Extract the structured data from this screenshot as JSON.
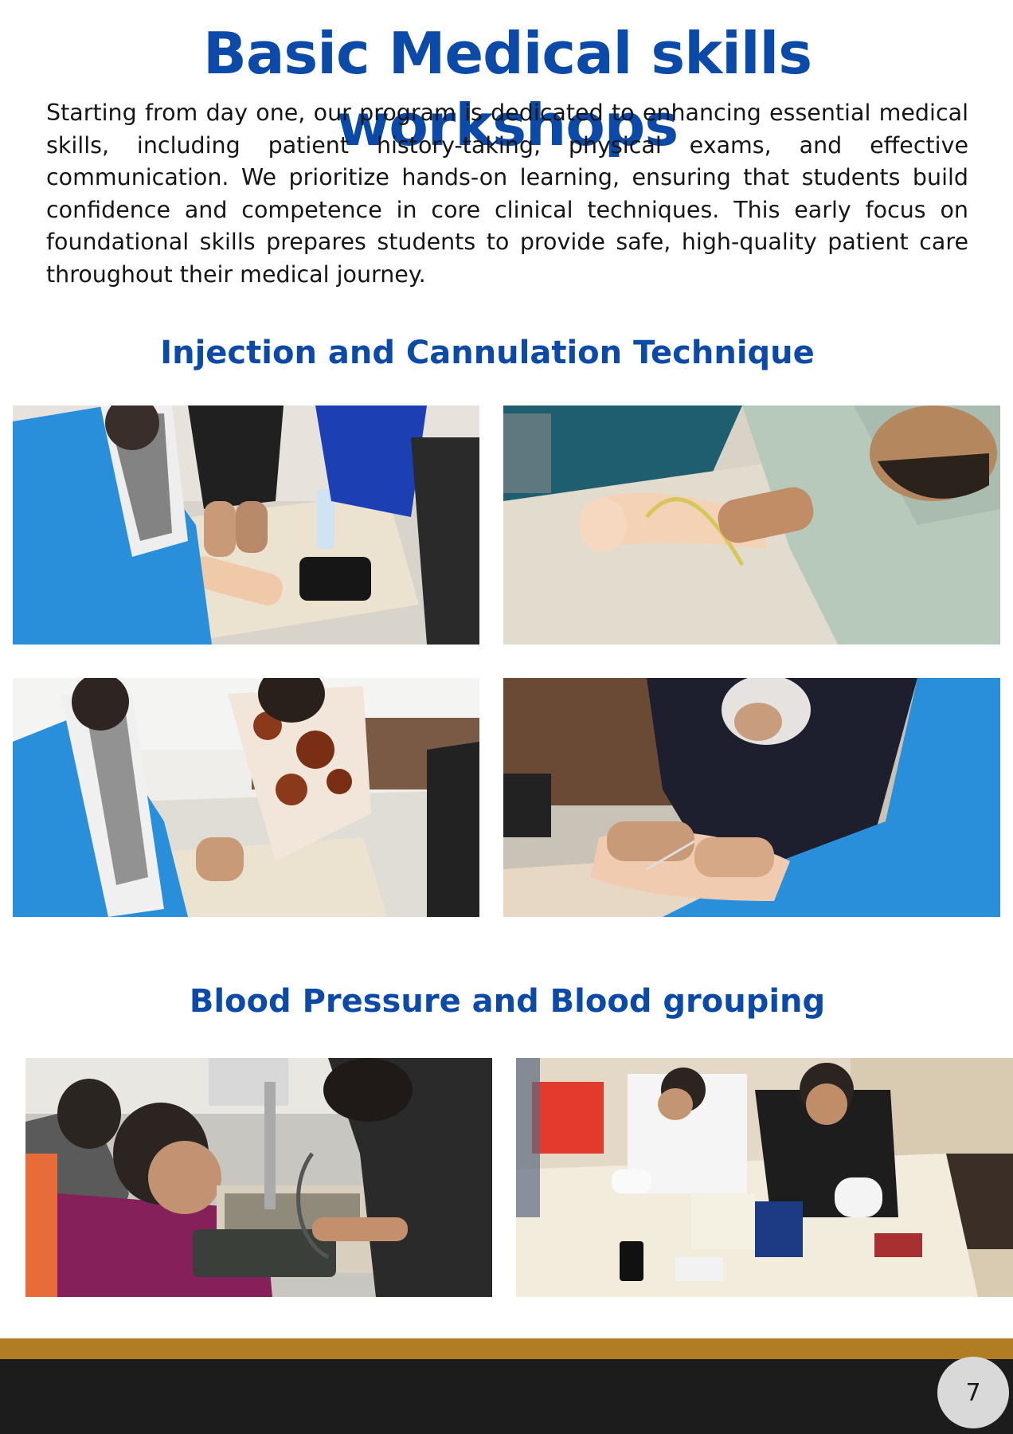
{
  "page": {
    "title": "Basic Medical skills workshops",
    "intro": "Starting from day one, our program is dedicated to enhancing essential medical skills, including patient history-taking, physical exams, and effective communication. We prioritize hands-on learning, ensuring that students build confidence and competence in core clinical techniques. This early focus on foundational skills prepares students to provide safe, high-quality patient care throughout their medical journey.",
    "page_number": "7"
  },
  "sections": [
    {
      "title": "Injection and Cannulation Technique"
    },
    {
      "title": "Blood Pressure and Blood grouping"
    }
  ],
  "colors": {
    "heading_blue": "#0b4aa8",
    "footer_gold": "#b07d24",
    "footer_dark": "#1c1c1c",
    "badge_grey": "#d9d9d9"
  }
}
